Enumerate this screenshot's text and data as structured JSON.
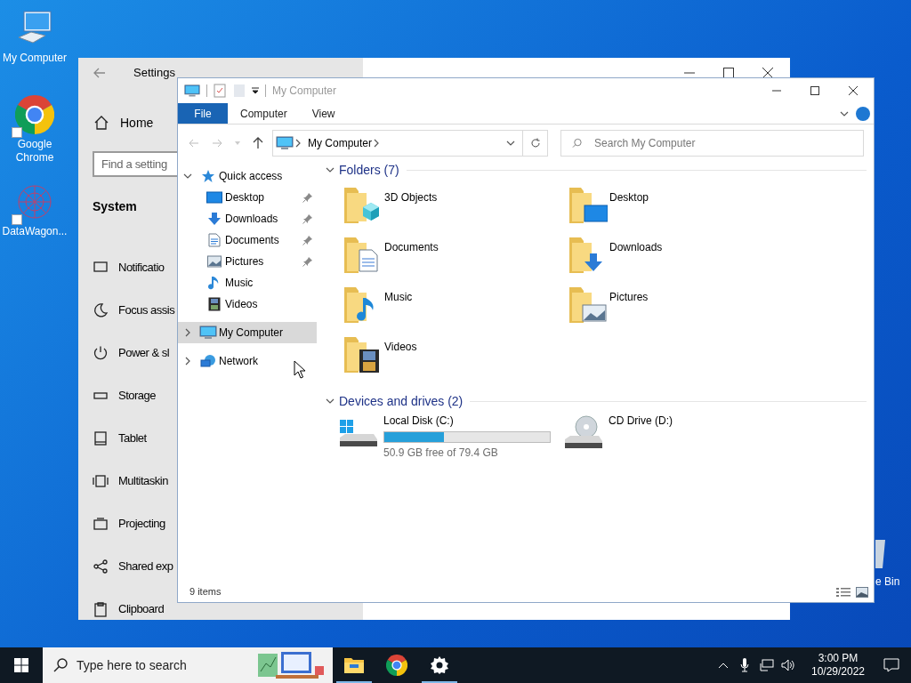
{
  "desktop_icons": [
    {
      "label": "My Computer",
      "kind": "computer"
    },
    {
      "label": "Google Chrome",
      "kind": "chrome"
    },
    {
      "label": "DataWagon...",
      "kind": "datawagon"
    }
  ],
  "recycle_bin": {
    "label": "e Bin"
  },
  "settings": {
    "title": "Settings",
    "home": "Home",
    "search": {
      "placeholder": "Find a setting"
    },
    "section": "System",
    "items": [
      {
        "label": "Notificatio",
        "kind": "message"
      },
      {
        "label": "Focus assis",
        "kind": "moon"
      },
      {
        "label": "Power & sl",
        "kind": "power"
      },
      {
        "label": "Storage",
        "kind": "storage"
      },
      {
        "label": "Tablet",
        "kind": "tablet"
      },
      {
        "label": "Multitaskin",
        "kind": "multitask"
      },
      {
        "label": "Projecting",
        "kind": "project"
      },
      {
        "label": "Shared exp",
        "kind": "shared"
      },
      {
        "label": "Clipboard",
        "kind": "clipboard"
      }
    ]
  },
  "explorer": {
    "title": "My Computer",
    "ribbon_tabs": [
      {
        "label": "File",
        "kind": "file"
      },
      {
        "label": "Computer",
        "kind": "tab"
      },
      {
        "label": "View",
        "kind": "tab"
      }
    ],
    "address": {
      "path": "My Computer"
    },
    "search": {
      "placeholder": "Search My Computer"
    },
    "nav": [
      {
        "label": "Quick access",
        "kind": "star",
        "expanded": true,
        "selected": false,
        "children": [
          {
            "label": "Desktop",
            "kind": "desktop",
            "pinned": true,
            "selected": false
          },
          {
            "label": "Downloads",
            "kind": "downloads",
            "pinned": true,
            "selected": false
          },
          {
            "label": "Documents",
            "kind": "documents",
            "pinned": true,
            "selected": false
          },
          {
            "label": "Pictures",
            "kind": "pictures",
            "pinned": true,
            "selected": false
          },
          {
            "label": "Music",
            "kind": "music",
            "pinned": false,
            "selected": false
          },
          {
            "label": "Videos",
            "kind": "videos",
            "pinned": false,
            "selected": false
          }
        ]
      },
      {
        "label": "My Computer",
        "kind": "computer",
        "expanded": false,
        "selected": true
      },
      {
        "label": "Network",
        "kind": "network",
        "expanded": false,
        "selected": false
      }
    ],
    "folders": {
      "heading": "Folders (7)",
      "items": [
        {
          "label": "3D Objects",
          "kind": "objects"
        },
        {
          "label": "Desktop",
          "kind": "desktop"
        },
        {
          "label": "Documents",
          "kind": "documents"
        },
        {
          "label": "Downloads",
          "kind": "downloads"
        },
        {
          "label": "Music",
          "kind": "music"
        },
        {
          "label": "Pictures",
          "kind": "pictures"
        },
        {
          "label": "Videos",
          "kind": "videos"
        }
      ]
    },
    "drives": {
      "heading": "Devices and drives (2)",
      "items": [
        {
          "label": "Local Disk (C:)",
          "kind": "disk",
          "level": 0.359,
          "reading": "50.9 GB free of 79.4 GB"
        },
        {
          "label": "CD Drive (D:)",
          "kind": "cd"
        }
      ]
    },
    "status": "9 items"
  },
  "taskbar": {
    "search": {
      "placeholder": "Type here to search"
    },
    "apps": [
      {
        "kind": "explorer",
        "running": true
      },
      {
        "kind": "chrome",
        "running": false
      },
      {
        "kind": "settings",
        "running": true
      }
    ],
    "time": "3:00 PM",
    "date": "10/29/2022"
  }
}
